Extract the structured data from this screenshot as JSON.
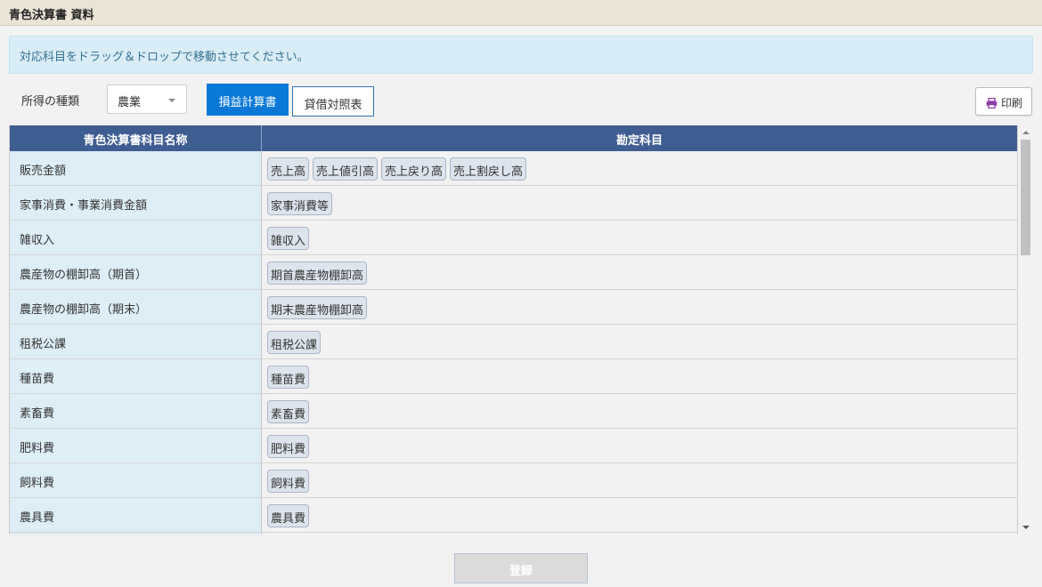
{
  "title": "青色決算書 資料",
  "notice": "対応科目をドラッグ＆ドロップで移動させてください。",
  "income_type": {
    "label": "所得の種類",
    "selected": "農業"
  },
  "tabs": [
    {
      "label": "損益計算書",
      "active": true
    },
    {
      "label": "貸借対照表",
      "active": false
    }
  ],
  "print_label": "印刷",
  "table": {
    "headers": [
      "青色決算書科目名称",
      "勘定科目"
    ],
    "rows": [
      {
        "name": "販売金額",
        "accounts": [
          "売上高",
          "売上値引高",
          "売上戻り高",
          "売上割戻し高"
        ]
      },
      {
        "name": "家事消費・事業消費金額",
        "accounts": [
          "家事消費等"
        ]
      },
      {
        "name": "雑収入",
        "accounts": [
          "雑収入"
        ]
      },
      {
        "name": "農産物の棚卸高（期首）",
        "accounts": [
          "期首農産物棚卸高"
        ]
      },
      {
        "name": "農産物の棚卸高（期末）",
        "accounts": [
          "期末農産物棚卸高"
        ]
      },
      {
        "name": "租税公課",
        "accounts": [
          "租税公課"
        ]
      },
      {
        "name": "種苗費",
        "accounts": [
          "種苗費"
        ]
      },
      {
        "name": "素畜費",
        "accounts": [
          "素畜費"
        ]
      },
      {
        "name": "肥料費",
        "accounts": [
          "肥料費"
        ]
      },
      {
        "name": "飼料費",
        "accounts": [
          "飼料費"
        ]
      },
      {
        "name": "農具費",
        "accounts": [
          "農具費"
        ]
      },
      {
        "name": "",
        "accounts": []
      }
    ]
  },
  "register_label": "登録",
  "colors": {
    "header_bg": "#3e5e92",
    "tab_active": "#0a79d8",
    "name_cell": "#ddeef7",
    "chip_bg": "#dde4ed"
  }
}
